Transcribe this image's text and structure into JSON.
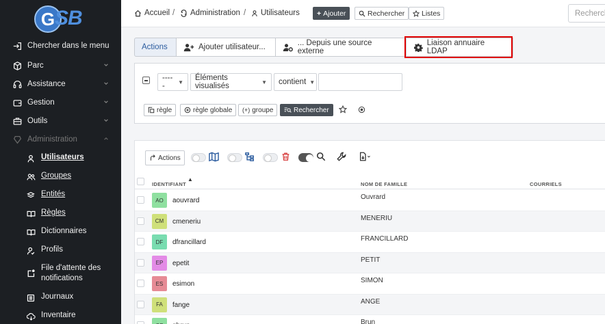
{
  "logo": {
    "letter": "G",
    "text": "SB"
  },
  "sidebar": {
    "items": [
      {
        "icon": "sign-in-icon",
        "label": "Chercher dans le menu"
      },
      {
        "icon": "cube-icon",
        "label": "Parc"
      },
      {
        "icon": "headset-icon",
        "label": "Assistance"
      },
      {
        "icon": "wallet-icon",
        "label": "Gestion"
      },
      {
        "icon": "briefcase-icon",
        "label": "Outils"
      },
      {
        "icon": "admin-icon",
        "label": "Administration"
      }
    ],
    "subitems": [
      {
        "icon": "user-icon",
        "label": "Utilisateurs",
        "active": true
      },
      {
        "icon": "users-icon",
        "label": "Groupes"
      },
      {
        "icon": "layers-icon",
        "label": "Entités"
      },
      {
        "icon": "book-icon",
        "label": "Règles"
      },
      {
        "icon": "book-open-icon",
        "label": "Dictionnaires"
      },
      {
        "icon": "user-check-icon",
        "label": "Profils"
      },
      {
        "icon": "notification-queue-icon",
        "label": "File d'attente des notifications"
      },
      {
        "icon": "log-icon",
        "label": "Journaux"
      },
      {
        "icon": "cloud-download-icon",
        "label": "Inventaire"
      }
    ]
  },
  "breadcrumb": {
    "home": "Accueil",
    "admin": "Administration",
    "current": "Utilisateurs",
    "sep": "/"
  },
  "toolbar": {
    "add": "Ajouter",
    "search": "Rechercher",
    "lists": "Listes",
    "search_placeholder": "Rechercher"
  },
  "tabs": {
    "actions": "Actions",
    "add_user": "Ajouter utilisateur...",
    "external": "... Depuis une source externe",
    "ldap": "Liaison annuaire LDAP"
  },
  "filter": {
    "field1": "-----",
    "field2": "Éléments visualisés",
    "operator": "contient",
    "value": "",
    "btn_rule": "règle",
    "btn_global_rule": "règle globale",
    "btn_group": "groupe",
    "btn_search": "Rechercher"
  },
  "table": {
    "actions_label": "Actions",
    "headers": {
      "login": "IDENTIFIANT",
      "lastname": "NOM DE FAMILLE",
      "emails": "COURRIELS"
    },
    "rows": [
      {
        "initials": "AO",
        "color": "#8fe0a0",
        "login": "aouvrard",
        "lastname": "Ouvrard"
      },
      {
        "initials": "CM",
        "color": "#cfe07a",
        "login": "cmeneriu",
        "lastname": "MENERIU"
      },
      {
        "initials": "DF",
        "color": "#79dcb0",
        "login": "dfrancillard",
        "lastname": "FRANCILLARD"
      },
      {
        "initials": "EP",
        "color": "#e38be6",
        "login": "epetit",
        "lastname": "PETIT"
      },
      {
        "initials": "ES",
        "color": "#e68b95",
        "login": "esimon",
        "lastname": "SIMON"
      },
      {
        "initials": "FA",
        "color": "#cfe07a",
        "login": "fange",
        "lastname": "ANGE"
      },
      {
        "initials": "GB",
        "color": "#8fe0a0",
        "login": "gbrun",
        "lastname": "Brun"
      }
    ]
  },
  "colors": {
    "sidebar_bg": "#1c1f23",
    "accent": "#2a5b9e",
    "highlight": "#e00000"
  }
}
